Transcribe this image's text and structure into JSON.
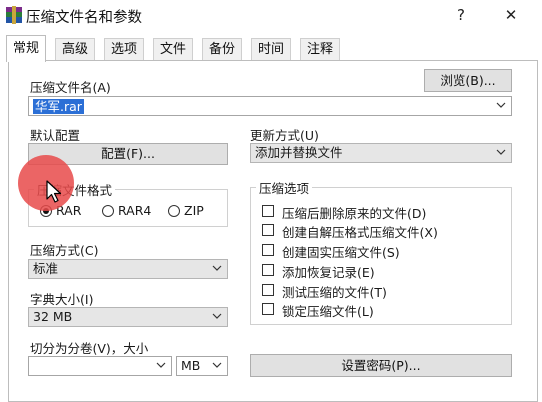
{
  "window": {
    "title": "压缩文件名和参数",
    "help_btn": "?",
    "close_btn": "✕"
  },
  "tabs": [
    {
      "label": "常规"
    },
    {
      "label": "高级"
    },
    {
      "label": "选项"
    },
    {
      "label": "文件"
    },
    {
      "label": "备份"
    },
    {
      "label": "时间"
    },
    {
      "label": "注释"
    }
  ],
  "archive_name": {
    "label": "压缩文件名(A)",
    "value": "华军.rar",
    "browse_label": "浏览(B)..."
  },
  "default_profile": {
    "label": "默认配置",
    "button_label": "配置(F)..."
  },
  "update_method": {
    "label": "更新方式(U)",
    "value": "添加并替换文件"
  },
  "archive_format": {
    "label": "压缩文件格式",
    "options": [
      {
        "label": "RAR",
        "checked": true
      },
      {
        "label": "RAR4",
        "checked": false
      },
      {
        "label": "ZIP",
        "checked": false
      }
    ]
  },
  "compression_method": {
    "label": "压缩方式(C)",
    "value": "标准"
  },
  "dictionary_size": {
    "label": "字典大小(I)",
    "value": "32 MB"
  },
  "split_volumes": {
    "label": "切分为分卷(V)，大小",
    "value": "",
    "unit": "MB"
  },
  "archive_options": {
    "label": "压缩选项",
    "items": [
      {
        "label": "压缩后删除原来的文件(D)",
        "checked": false
      },
      {
        "label": "创建自解压格式压缩文件(X)",
        "checked": false
      },
      {
        "label": "创建固实压缩文件(S)",
        "checked": false
      },
      {
        "label": "添加恢复记录(E)",
        "checked": false
      },
      {
        "label": "测试压缩的文件(T)",
        "checked": false
      },
      {
        "label": "锁定压缩文件(L)",
        "checked": false
      }
    ]
  },
  "set_password": {
    "label": "设置密码(P)..."
  }
}
